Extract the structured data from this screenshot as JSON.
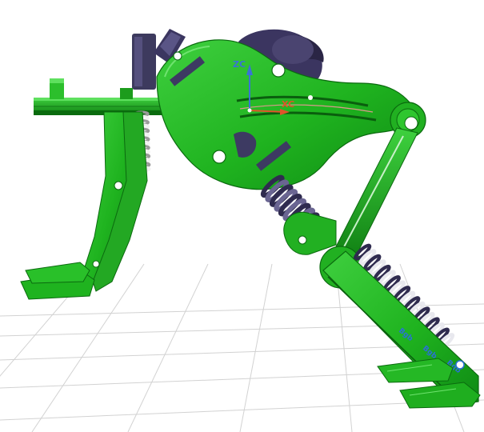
{
  "viewport": {
    "background": "#ffffff",
    "grid_color": "#cfcfcf"
  },
  "model": {
    "body_color": "#1fb31f",
    "body_dark": "#0e7a12",
    "body_light": "#47d447",
    "motor_color": "#3b3560",
    "spring_color": "#2f2b4f",
    "spring_light": "#e8e8ee",
    "silver": "#d7d7d7"
  },
  "axes": {
    "zc_label": "ZC",
    "xc_label": "XC",
    "zc_color": "#3a72d6",
    "xc_color": "#e0542a"
  },
  "decals": {
    "label_1": "Bgb",
    "label_2": "Bgb",
    "label_3": "Bgb",
    "decal_color": "#2a6fd8"
  }
}
